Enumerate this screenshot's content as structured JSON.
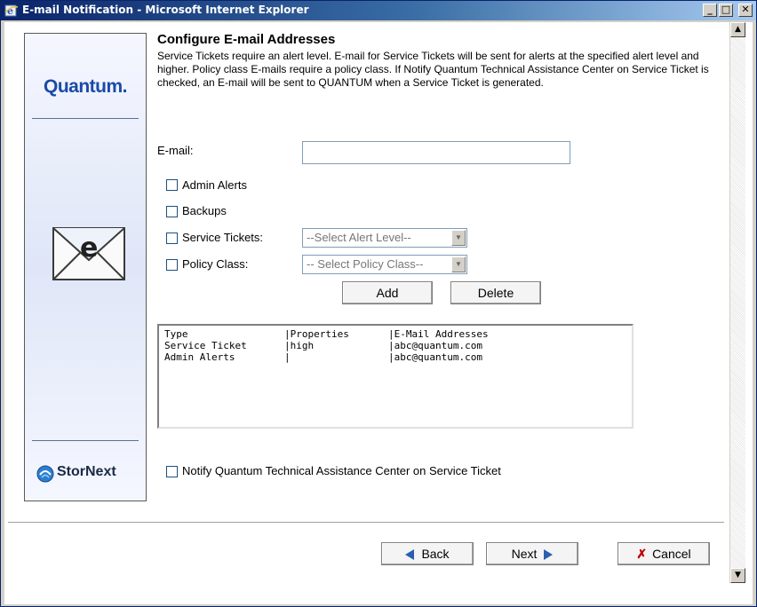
{
  "window": {
    "title": "E-mail Notification - Microsoft Internet Explorer",
    "min_glyph": "_",
    "max_glyph": "□",
    "close_glyph": "✕"
  },
  "brand": {
    "logo_text": "Quantum.",
    "product_text": "StorNext",
    "accent_color": "#1b4aa8"
  },
  "page": {
    "heading": "Configure E-mail Addresses",
    "description": "Service Tickets require an alert level. E-mail for Service Tickets will be sent for alerts at the specified alert level and higher. Policy class E-mails require a policy class. If Notify Quantum Technical Assistance Center on Service Ticket is checked, an E-mail will be sent to QUANTUM when a Service Ticket is generated."
  },
  "form": {
    "email_label": "E-mail:",
    "email_value": "",
    "admin_alerts_label": "Admin Alerts",
    "backups_label": "Backups",
    "service_tickets_label": "Service Tickets:",
    "service_tickets_select": "--Select Alert Level--",
    "policy_class_label": "Policy Class:",
    "policy_class_select": "-- Select Policy Class--",
    "add_label": "Add",
    "delete_label": "Delete",
    "notify_label": "Notify Quantum Technical Assistance Center on Service Ticket"
  },
  "list": {
    "headers": [
      "Type",
      "|Properties",
      "|E-Mail Addresses"
    ],
    "rows": [
      [
        "Service Ticket",
        "|high",
        "|abc@quantum.com"
      ],
      [
        "Admin Alerts",
        "|",
        "|abc@quantum.com"
      ]
    ]
  },
  "footer": {
    "back_label": "Back",
    "next_label": "Next",
    "cancel_label": "Cancel"
  },
  "colors": {
    "titlebar_start": "#0a246a",
    "arrow_blue": "#2a5fb0",
    "cancel_red": "#c00000"
  }
}
